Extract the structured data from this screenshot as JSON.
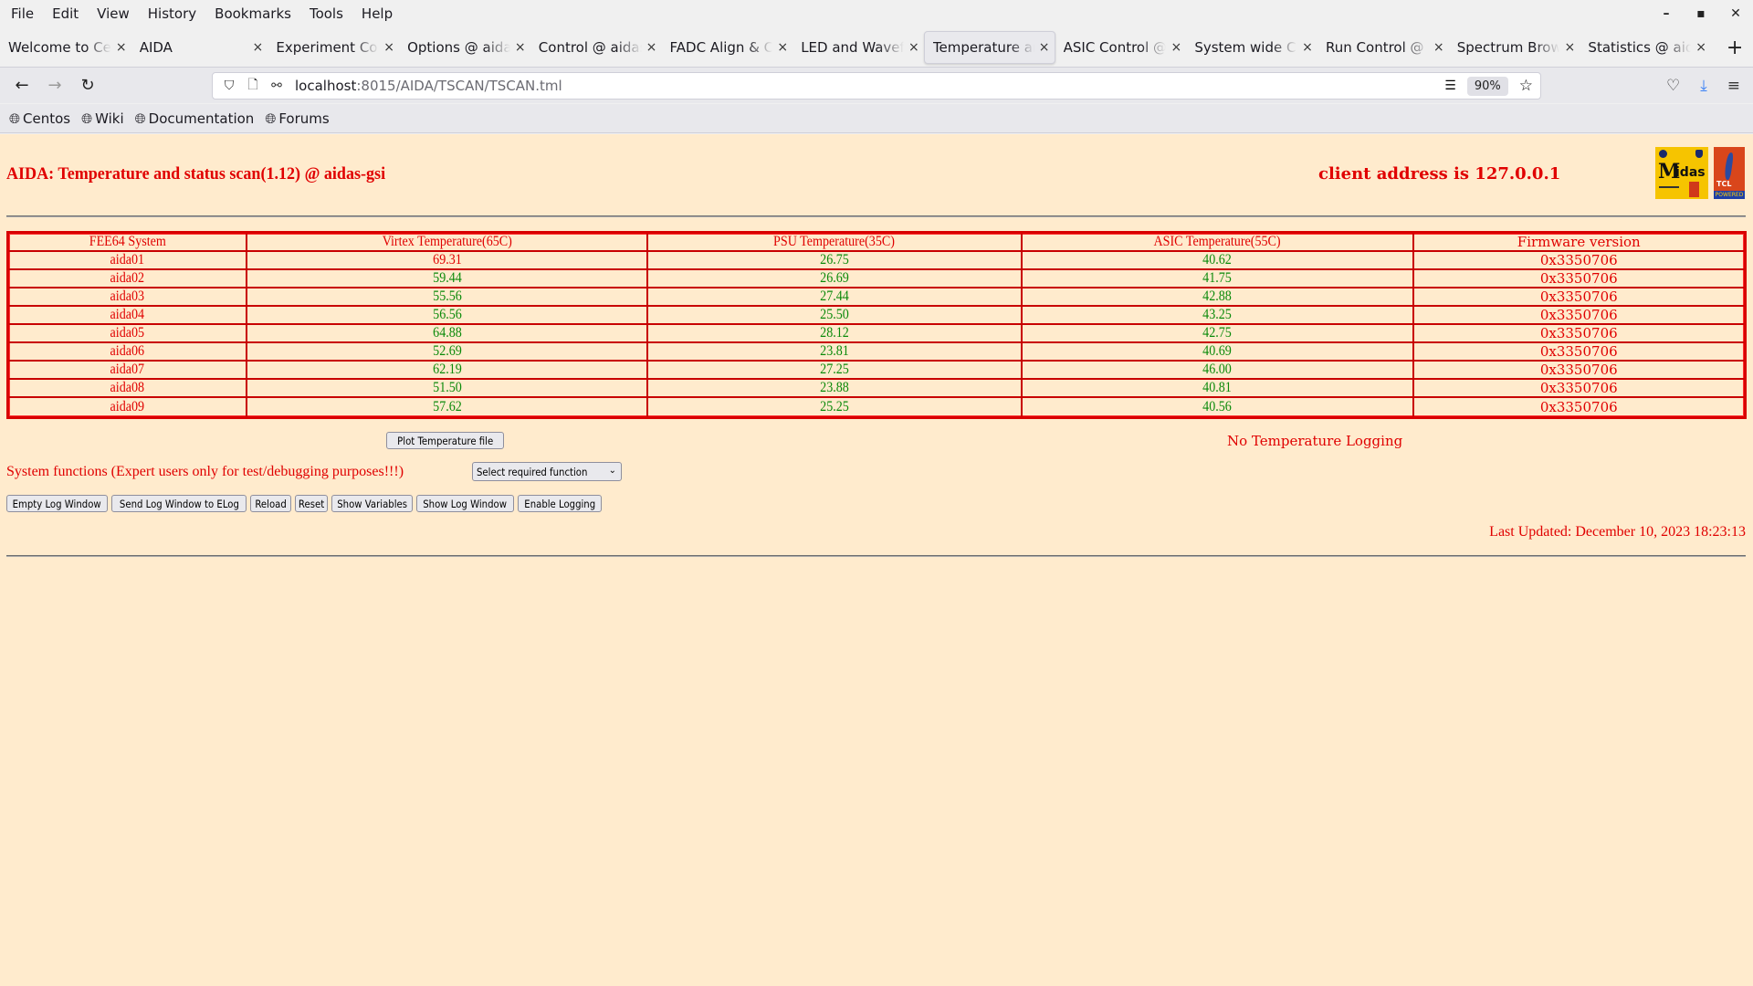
{
  "browser": {
    "menu": [
      "File",
      "Edit",
      "View",
      "History",
      "Bookmarks",
      "Tools",
      "Help"
    ],
    "window_controls": {
      "minimize": "–",
      "maximize": "▪",
      "close": "✕"
    },
    "tabs": [
      {
        "label": "Welcome to Centos",
        "active": false
      },
      {
        "label": "AIDA",
        "active": false
      },
      {
        "label": "Experiment Control",
        "active": false
      },
      {
        "label": "Options @ aidas-gsi",
        "active": false
      },
      {
        "label": "Control @ aidas-gsi",
        "active": false
      },
      {
        "label": "FADC Align & Control",
        "active": false
      },
      {
        "label": "LED and Waveform",
        "active": false
      },
      {
        "label": "Temperature and status scan",
        "active": true
      },
      {
        "label": "ASIC Control @ aidas-gsi",
        "active": false
      },
      {
        "label": "System wide Checks",
        "active": false
      },
      {
        "label": "Run Control @ aidas-gsi",
        "active": false
      },
      {
        "label": "Spectrum Browser",
        "active": false
      },
      {
        "label": "Statistics @ aidas-gsi",
        "active": false
      }
    ],
    "url_host": "localhost",
    "url_rest": ":8015/AIDA/TSCAN/TSCAN.tml",
    "zoom_level": "90%",
    "bookmarks": [
      "Centos",
      "Wiki",
      "Documentation",
      "Forums"
    ]
  },
  "page": {
    "title": "AIDA: Temperature and status scan(1.12) @ aidas-gsi",
    "client_address": "client address is 127.0.0.1",
    "logos": {
      "midas": "Midas",
      "tcl": "TCL",
      "tcl_powered": "POWERED"
    },
    "table": {
      "headers": [
        "FEE64 System",
        "Virtex Temperature(65C)",
        "PSU Temperature(35C)",
        "ASIC Temperature(55C)",
        "Firmware version"
      ],
      "rows": [
        {
          "system": "aida01",
          "virtex": "69.31",
          "virtex_alarm": true,
          "psu": "26.75",
          "asic": "40.62",
          "firmware": "0x3350706"
        },
        {
          "system": "aida02",
          "virtex": "59.44",
          "virtex_alarm": false,
          "psu": "26.69",
          "asic": "41.75",
          "firmware": "0x3350706"
        },
        {
          "system": "aida03",
          "virtex": "55.56",
          "virtex_alarm": false,
          "psu": "27.44",
          "asic": "42.88",
          "firmware": "0x3350706"
        },
        {
          "system": "aida04",
          "virtex": "56.56",
          "virtex_alarm": false,
          "psu": "25.50",
          "asic": "43.25",
          "firmware": "0x3350706"
        },
        {
          "system": "aida05",
          "virtex": "64.88",
          "virtex_alarm": false,
          "psu": "28.12",
          "asic": "42.75",
          "firmware": "0x3350706"
        },
        {
          "system": "aida06",
          "virtex": "52.69",
          "virtex_alarm": false,
          "psu": "23.81",
          "asic": "40.69",
          "firmware": "0x3350706"
        },
        {
          "system": "aida07",
          "virtex": "62.19",
          "virtex_alarm": false,
          "psu": "27.25",
          "asic": "46.00",
          "firmware": "0x3350706"
        },
        {
          "system": "aida08",
          "virtex": "51.50",
          "virtex_alarm": false,
          "psu": "23.88",
          "asic": "40.81",
          "firmware": "0x3350706"
        },
        {
          "system": "aida09",
          "virtex": "57.62",
          "virtex_alarm": false,
          "psu": "25.25",
          "asic": "40.56",
          "firmware": "0x3350706"
        }
      ]
    },
    "plot_button": "Plot Temperature file",
    "logging_status": "No Temperature Logging",
    "system_functions_label": "System functions (Expert users only for test/debugging purposes!!!)",
    "function_select": {
      "selected": "Select required function"
    },
    "action_buttons": [
      "Empty Log Window",
      "Send Log Window to ELog",
      "Reload",
      "Reset",
      "Show Variables",
      "Show Log Window",
      "Enable Logging"
    ],
    "last_updated": "Last Updated: December 10, 2023 18:23:13"
  },
  "colors": {
    "page_background": "#ffebcd",
    "accent_red": "#e00000",
    "ok_green": "#0a8a0a",
    "table_border": "#d80000"
  }
}
